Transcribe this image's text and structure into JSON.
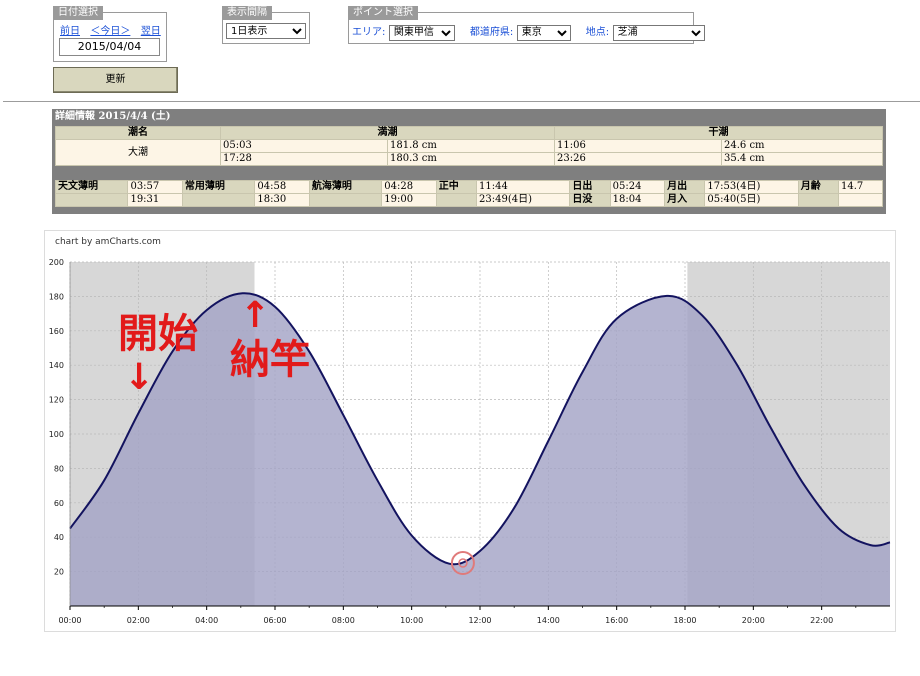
{
  "date_panel": {
    "title": "日付選択",
    "prev": "前日",
    "today": "＜今日＞",
    "next": "翌日",
    "date_value": "2015/04/04",
    "update_label": "更新"
  },
  "interval_panel": {
    "title": "表示間隔",
    "selected": "1日表示"
  },
  "point_panel": {
    "title": "ポイント選択",
    "area_label": "エリア:",
    "area_value": "関東甲信",
    "pref_label": "都道府県:",
    "pref_value": "東京",
    "place_label": "地点:",
    "place_value": "芝浦"
  },
  "detail": {
    "title": "詳細情報  2015/4/4 (土)",
    "col_tide_name": "潮名",
    "col_high": "満潮",
    "col_low": "干潮",
    "tide_name": "大潮",
    "high": [
      {
        "time": "05:03",
        "height": "181.8 cm"
      },
      {
        "time": "17:28",
        "height": "180.3 cm"
      }
    ],
    "low": [
      {
        "time": "11:06",
        "height": "24.6 cm"
      },
      {
        "time": "23:26",
        "height": "35.4 cm"
      }
    ],
    "sun": {
      "astro_label": "天文薄明",
      "astro_am": "03:57",
      "astro_pm": "19:31",
      "civil_label": "常用薄明",
      "civil_am": "04:58",
      "civil_pm": "18:30",
      "naut_label": "航海薄明",
      "naut_am": "04:28",
      "naut_pm": "19:00",
      "noon_label": "正中",
      "noon_1": "11:44",
      "noon_2": "23:49(4日)",
      "sunrise_label": "日出",
      "sunrise": "05:24",
      "sunset_label": "日没",
      "sunset": "18:04",
      "moonrise_label": "月出",
      "moonrise": "17:53(4日)",
      "moonset_label": "月入",
      "moonset": "05:40(5日)",
      "moonage_label": "月齢",
      "moonage": "14.7"
    }
  },
  "chart_data": {
    "type": "area",
    "credit": "chart by amCharts.com",
    "x_unit": "hour",
    "xlim": [
      0,
      24
    ],
    "ylim": [
      0,
      200
    ],
    "yticks": [
      20,
      40,
      60,
      80,
      100,
      120,
      140,
      160,
      180,
      200
    ],
    "xticks": [
      "00:00",
      "02:00",
      "04:00",
      "06:00",
      "08:00",
      "10:00",
      "12:00",
      "14:00",
      "16:00",
      "18:00",
      "20:00",
      "22:00"
    ],
    "grid": true,
    "night_before": 5.4,
    "night_after": 18.07,
    "series": [
      {
        "x": [
          0,
          1,
          2,
          3,
          4,
          5.05,
          6,
          7,
          8,
          9,
          10,
          11.1,
          12,
          13,
          14,
          15,
          16,
          17.47,
          18.5,
          19.5,
          20.5,
          21.5,
          22.5,
          23.43,
          24
        ],
        "y": [
          45,
          73,
          112,
          148,
          172,
          181.8,
          174,
          148,
          111,
          73,
          41,
          24.6,
          32,
          57,
          96,
          136,
          167,
          180.3,
          169,
          141,
          104,
          70,
          45,
          35.4,
          37
        ]
      }
    ],
    "marker": {
      "x": 11.5,
      "y": 25
    },
    "fill_color": "#a3a3c6",
    "line_color": "#13135f",
    "night_color": "#d7d7d7"
  },
  "annotations": {
    "start": {
      "text": "開始",
      "arrow": "↓"
    },
    "nousan": {
      "text": "納竿",
      "arrow": "↑"
    },
    "color": "#e21a1a"
  }
}
